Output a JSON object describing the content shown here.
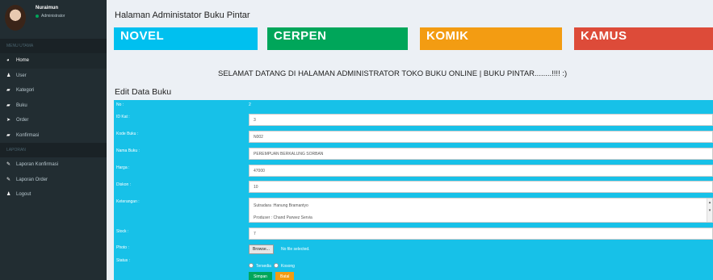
{
  "sidebar": {
    "user_name": "Nuraimun",
    "user_role": "Administrator",
    "section_main": "MENU UTAMA",
    "section_report": "LAPORAN",
    "items": [
      {
        "label": "Home",
        "icon": "dashboard-icon"
      },
      {
        "label": "User",
        "icon": "user-icon"
      },
      {
        "label": "Kategori",
        "icon": "folder-icon"
      },
      {
        "label": "Buku",
        "icon": "folder-icon"
      },
      {
        "label": "Order",
        "icon": "send-icon"
      },
      {
        "label": "Konfirmasi",
        "icon": "folder-icon"
      }
    ],
    "report_items": [
      {
        "label": "Laporan Konfirmasi",
        "icon": "edit-icon"
      },
      {
        "label": "Laporan Order",
        "icon": "edit-icon"
      },
      {
        "label": "Logout",
        "icon": "user-icon"
      }
    ]
  },
  "header": {
    "title": "Halaman Administator Buku Pintar"
  },
  "tiles": [
    {
      "label": "NOVEL",
      "color": "#00c0ef"
    },
    {
      "label": "CERPEN",
      "color": "#00a65a"
    },
    {
      "label": "KOMIK",
      "color": "#f39c12"
    },
    {
      "label": "KAMUS",
      "color": "#dd4b39"
    }
  ],
  "welcome": "SELAMAT DATANG DI HALAMAN ADMINISTRATOR TOKO BUKU ONLINE | BUKU PINTAR........!!!! :)",
  "form": {
    "title": "Edit Data Buku",
    "no_label": "No :",
    "no_value": "2",
    "id_kat_label": "ID Kat :",
    "id_kat_value": "3",
    "kode_label": "Kode Buku :",
    "kode_value": "N002",
    "nama_label": "Nama Buku :",
    "nama_value": "PEREMPUAN BERKALUNG SORBAN",
    "harga_label": "Harga :",
    "harga_value": "47000",
    "diskon_label": "Diskon :",
    "diskon_value": "10",
    "keterangan_label": "Keterangan :",
    "keterangan_line1": "Sutradara :Hanung Bramantyo",
    "keterangan_line2": "Produser : Chand Parwez Servia",
    "stock_label": "Stock :",
    "stock_value": "7",
    "photo_label": "Photo :",
    "browse_label": "Browse...",
    "no_file": "No file selected.",
    "status_label": "Status :",
    "status_option1": "Tersedia",
    "status_option2": "Kosong",
    "save_label": "Simpan",
    "cancel_label": "Batal",
    "save_color": "#00a65a",
    "cancel_color": "#f39c12"
  }
}
